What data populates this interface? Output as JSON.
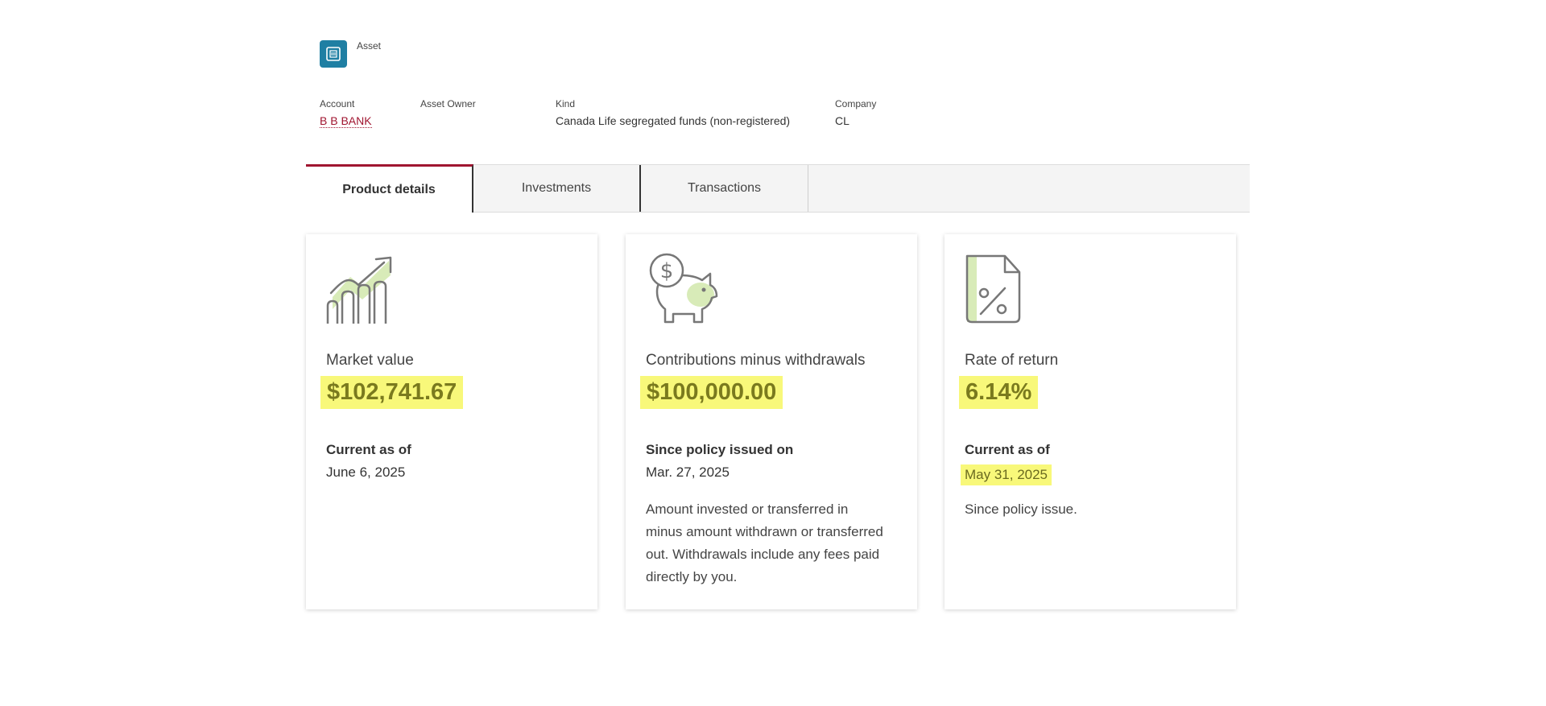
{
  "header": {
    "label": "Asset",
    "icon": "safe-icon"
  },
  "fields": {
    "account": {
      "label": "Account",
      "value": "B B BANK"
    },
    "asset_owner": {
      "label": "Asset Owner",
      "value": ""
    },
    "kind": {
      "label": "Kind",
      "value": "Canada Life segregated funds (non-registered)"
    },
    "company": {
      "label": "Company",
      "value": "CL"
    }
  },
  "tabs": [
    {
      "label": "Product details",
      "active": true
    },
    {
      "label": "Investments",
      "active": false
    },
    {
      "label": "Transactions",
      "active": false
    }
  ],
  "cards": [
    {
      "icon": "growth-chart-icon",
      "title": "Market value",
      "amount": "$102,741.67",
      "sub_label": "Current as of",
      "sub_value": "June 6, 2025"
    },
    {
      "icon": "piggy-bank-icon",
      "title": "Contributions minus withdrawals",
      "amount": "$100,000.00",
      "sub_label": "Since policy issued on",
      "sub_value": "Mar. 27, 2025",
      "description": "Amount invested or transferred in minus amount withdrawn or transferred out. Withdrawals include any fees paid directly by you."
    },
    {
      "icon": "percent-document-icon",
      "title": "Rate of return",
      "amount": "6.14%",
      "sub_label": "Current as of",
      "sub_value": "May 31, 2025",
      "description": "Since policy issue."
    }
  ],
  "colors": {
    "accent": "#a01530",
    "header_icon": "#1f7fa3",
    "highlight": "#f8f87a",
    "icon_fill": "#d8ebb8"
  }
}
